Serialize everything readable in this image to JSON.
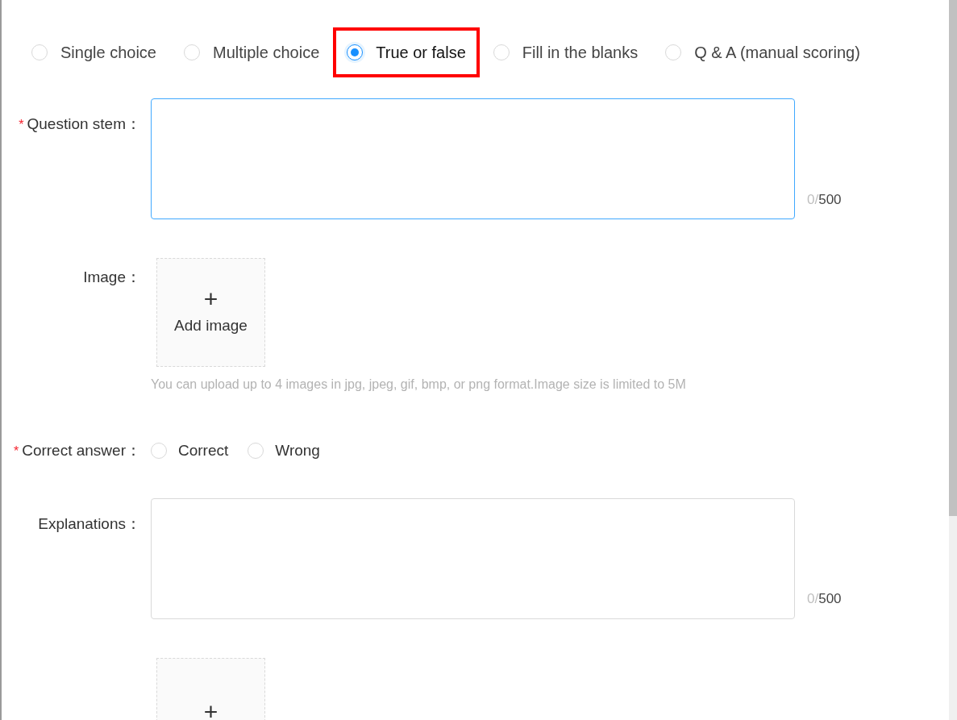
{
  "question_types": [
    {
      "label": "Single choice",
      "selected": false
    },
    {
      "label": "Multiple choice",
      "selected": false
    },
    {
      "label": "True or false",
      "selected": true
    },
    {
      "label": "Fill in the blanks",
      "selected": false
    },
    {
      "label": "Q & A (manual scoring)",
      "selected": false
    }
  ],
  "fields": [
    {
      "kind": "textarea",
      "label": "Question stem：",
      "required_mark": "*",
      "count": "0/",
      "limit": "500"
    },
    {
      "kind": "upload",
      "label": "Image：",
      "plus": "+",
      "button": "Add image",
      "hint": "You can upload up to 4 images in jpg, jpeg, gif, bmp, or png format.Image size is limited to 5M"
    },
    {
      "kind": "radio",
      "label": "Correct answer：",
      "required_mark": "*",
      "options": [
        {
          "label": "Correct",
          "selected": false
        },
        {
          "label": "Wrong",
          "selected": false
        }
      ]
    },
    {
      "kind": "textarea",
      "label": "Explanations：",
      "count": "0/",
      "limit": "500"
    },
    {
      "kind": "upload_cut",
      "plus": "+"
    }
  ]
}
